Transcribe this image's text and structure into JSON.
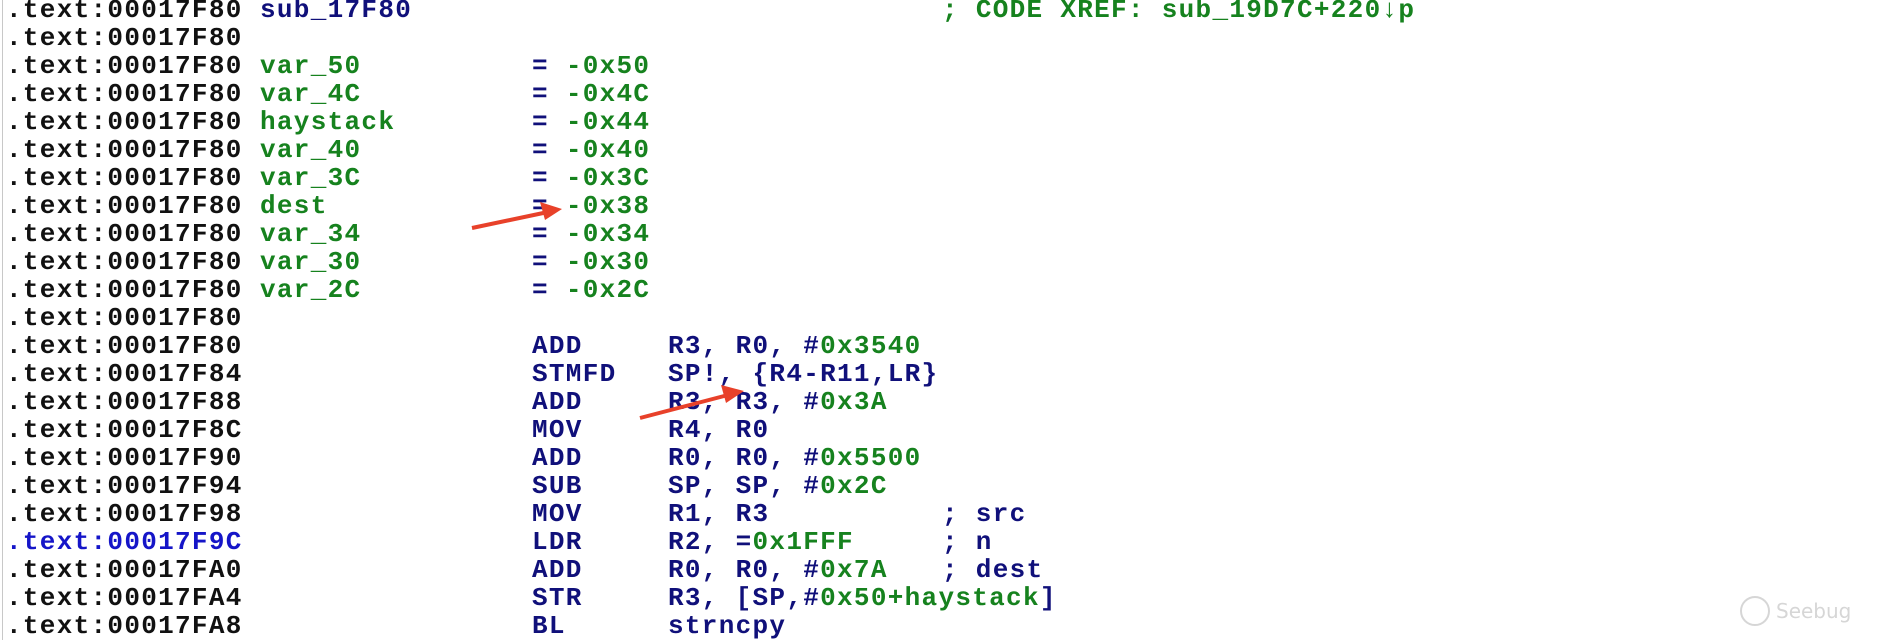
{
  "colors": {
    "address": "#111111",
    "address_highlight": "#1515c8",
    "navy": "#10107a",
    "green": "#16821e",
    "arrow": "#e8412a"
  },
  "rows": [
    {
      "address": ".text:00017F80",
      "label": "sub_17F80",
      "label_color": "navy",
      "comment": [
        [
          "; ",
          "g"
        ],
        [
          "CODE XREF: sub_19D7C+220↓p",
          "g"
        ]
      ]
    },
    {
      "address": ".text:00017F80"
    },
    {
      "address": ".text:00017F80",
      "label": "var_50",
      "eq": "= ",
      "value": "-0x50"
    },
    {
      "address": ".text:00017F80",
      "label": "var_4C",
      "eq": "= ",
      "value": "-0x4C"
    },
    {
      "address": ".text:00017F80",
      "label": "haystack",
      "eq": "= ",
      "value": "-0x44"
    },
    {
      "address": ".text:00017F80",
      "label": "var_40",
      "eq": "= ",
      "value": "-0x40"
    },
    {
      "address": ".text:00017F80",
      "label": "var_3C",
      "eq": "= ",
      "value": "-0x3C"
    },
    {
      "address": ".text:00017F80",
      "label": "dest",
      "eq": "= ",
      "value": "-0x38"
    },
    {
      "address": ".text:00017F80",
      "label": "var_34",
      "eq": "= ",
      "value": "-0x34"
    },
    {
      "address": ".text:00017F80",
      "label": "var_30",
      "eq": "= ",
      "value": "-0x30"
    },
    {
      "address": ".text:00017F80",
      "label": "var_2C",
      "eq": "= ",
      "value": "-0x2C"
    },
    {
      "address": ".text:00017F80"
    },
    {
      "address": ".text:00017F80",
      "mnemonic": "ADD",
      "operands": [
        [
          "R3, R0, #",
          "n"
        ],
        [
          "0x3540",
          "g"
        ]
      ]
    },
    {
      "address": ".text:00017F84",
      "mnemonic": "STMFD",
      "operands": [
        [
          "SP!, {R4-R11,LR}",
          "n"
        ]
      ]
    },
    {
      "address": ".text:00017F88",
      "mnemonic": "ADD",
      "operands": [
        [
          "R3, R3, #",
          "n"
        ],
        [
          "0x3A",
          "g"
        ]
      ]
    },
    {
      "address": ".text:00017F8C",
      "mnemonic": "MOV",
      "operands": [
        [
          "R4, R0",
          "n"
        ]
      ]
    },
    {
      "address": ".text:00017F90",
      "mnemonic": "ADD",
      "operands": [
        [
          "R0, R0, #",
          "n"
        ],
        [
          "0x5500",
          "g"
        ]
      ]
    },
    {
      "address": ".text:00017F94",
      "mnemonic": "SUB",
      "operands": [
        [
          "SP, SP, #",
          "n"
        ],
        [
          "0x2C",
          "g"
        ]
      ]
    },
    {
      "address": ".text:00017F98",
      "mnemonic": "MOV",
      "operands": [
        [
          "R1, R3",
          "n"
        ]
      ],
      "comment": [
        [
          "; src",
          "n"
        ]
      ]
    },
    {
      "address": ".text:00017F9C",
      "highlight": true,
      "mnemonic": "LDR",
      "operands": [
        [
          "R2, =",
          "n"
        ],
        [
          "0x1FFF",
          "g"
        ]
      ],
      "comment": [
        [
          "; n",
          "n"
        ]
      ]
    },
    {
      "address": ".text:00017FA0",
      "mnemonic": "ADD",
      "operands": [
        [
          "R0, R0, #",
          "n"
        ],
        [
          "0x7A",
          "g"
        ]
      ],
      "comment": [
        [
          "; dest",
          "n"
        ]
      ]
    },
    {
      "address": ".text:00017FA4",
      "mnemonic": "STR",
      "operands": [
        [
          "R3, [SP,#",
          "n"
        ],
        [
          "0x50+haystack",
          "g"
        ],
        [
          "]",
          "n"
        ]
      ]
    },
    {
      "address": ".text:00017FA8",
      "mnemonic": "BL",
      "operands": [
        [
          "strncpy",
          "n"
        ]
      ]
    }
  ],
  "watermark": {
    "text": "Seebug"
  }
}
